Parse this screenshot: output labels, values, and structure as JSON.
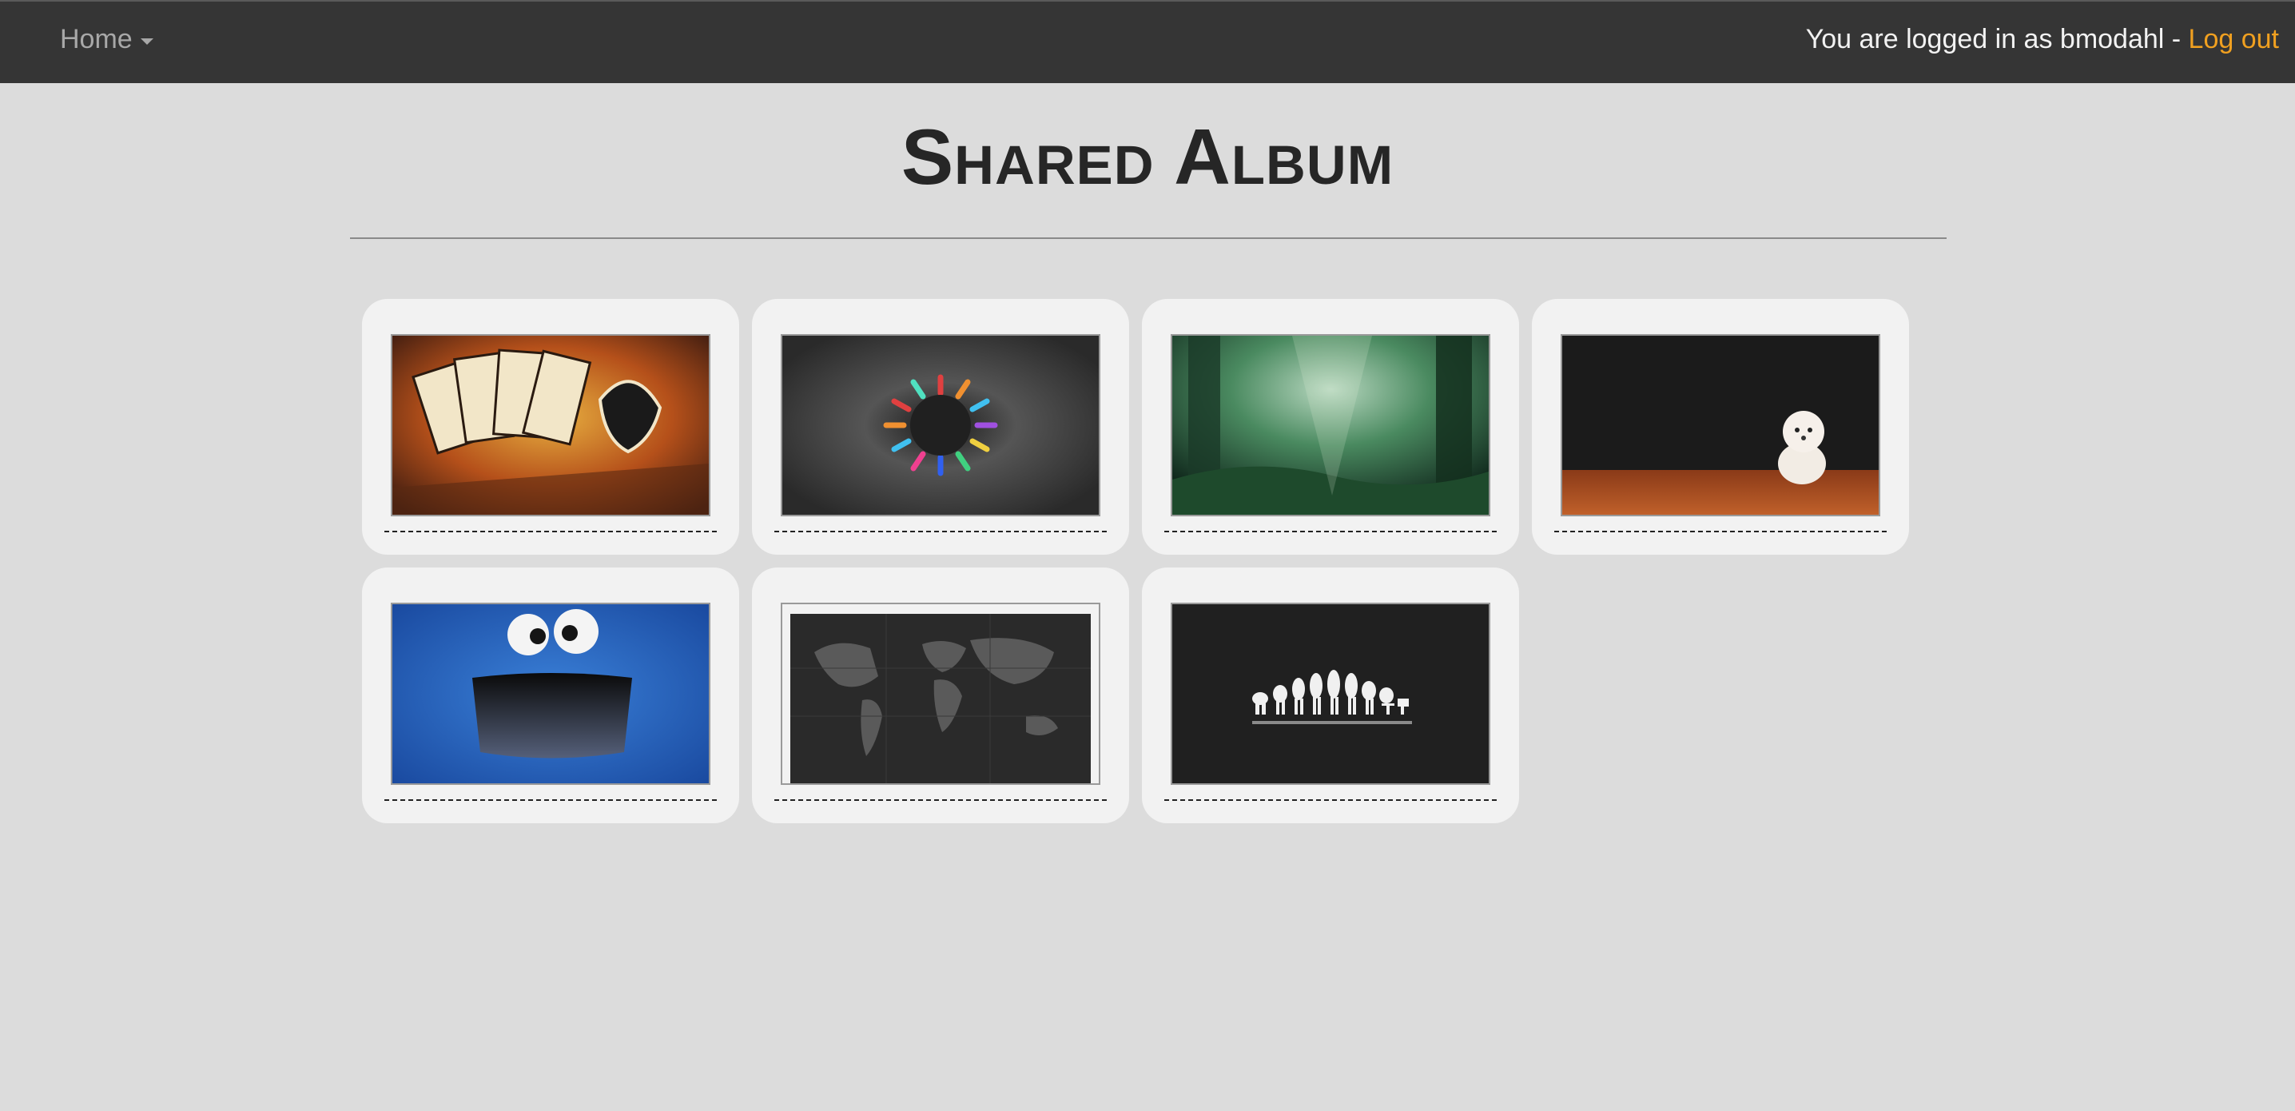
{
  "navbar": {
    "home_label": "Home",
    "login_text": "You are logged in as bmodahl - ",
    "logout_label": "Log out"
  },
  "page": {
    "title": "Shared Album"
  },
  "album": {
    "photos": [
      {
        "subject": "playing cards royal flush",
        "caption": ""
      },
      {
        "subject": "colorful radial burst",
        "caption": ""
      },
      {
        "subject": "misty green forest",
        "caption": ""
      },
      {
        "subject": "white puppy on wood floor",
        "caption": ""
      },
      {
        "subject": "blue furry monster",
        "caption": ""
      },
      {
        "subject": "dark world map",
        "caption": ""
      },
      {
        "subject": "evolution silhouettes",
        "caption": ""
      }
    ]
  },
  "colors": {
    "navbar_bg": "#353535",
    "page_bg": "#dcdcdc",
    "card_bg": "#f2f2f2",
    "logout_accent": "#f0a020"
  }
}
